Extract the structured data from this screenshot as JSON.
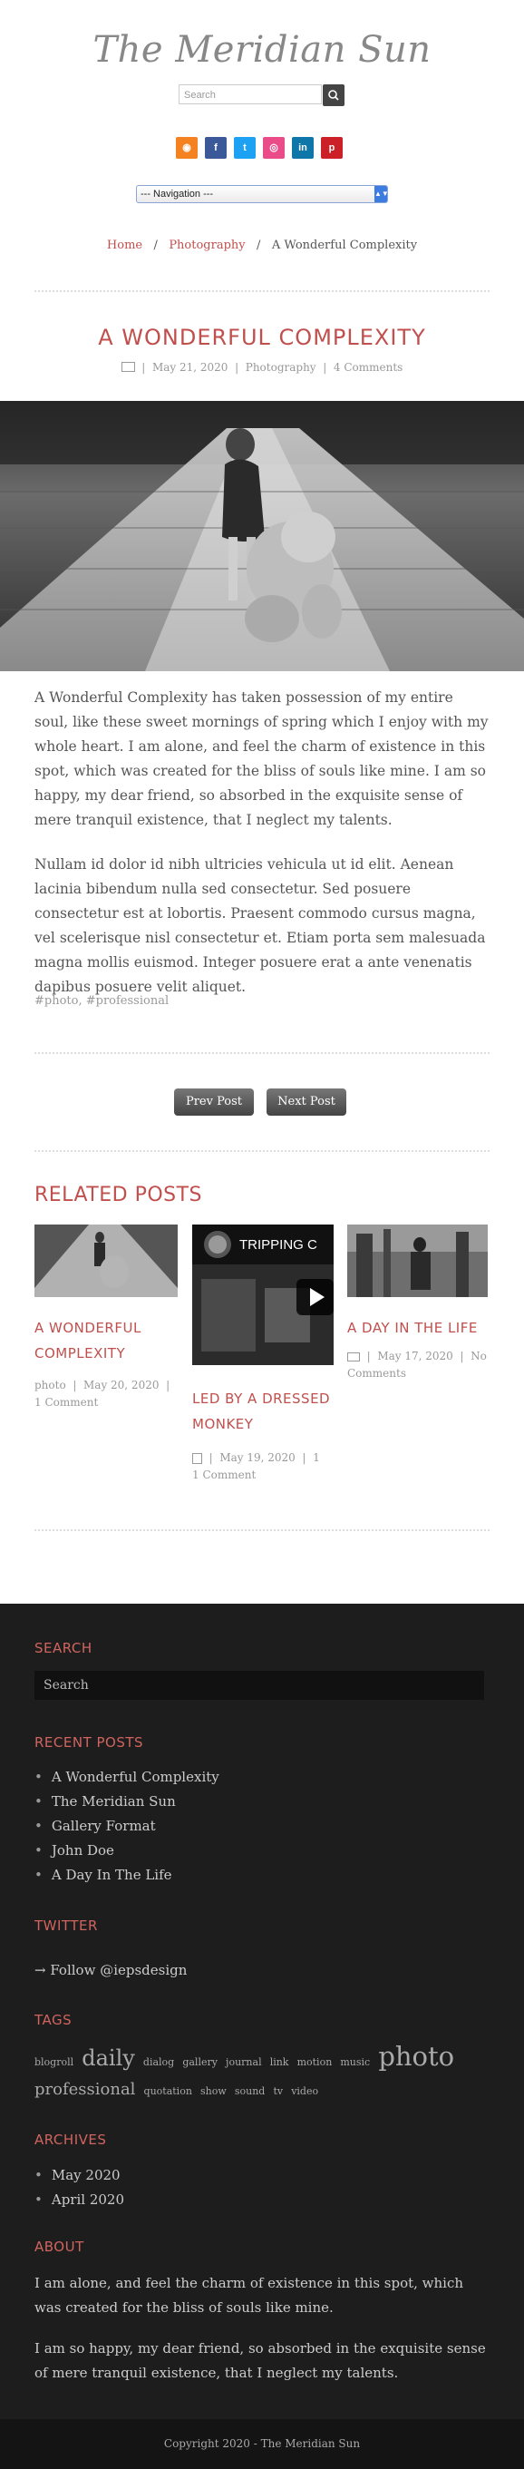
{
  "site": {
    "title": "The Meridian Sun",
    "search_placeholder": "Search"
  },
  "social": [
    {
      "name": "rss",
      "color": "#f58220",
      "glyph": "◉"
    },
    {
      "name": "facebook",
      "color": "#3b5998",
      "glyph": "f"
    },
    {
      "name": "twitter",
      "color": "#1da1f2",
      "glyph": "t"
    },
    {
      "name": "dribbble",
      "color": "#ea4c89",
      "glyph": "◎"
    },
    {
      "name": "linkedin",
      "color": "#0e76a8",
      "glyph": "in"
    },
    {
      "name": "pinterest",
      "color": "#cb2027",
      "glyph": "p"
    }
  ],
  "nav": {
    "selected": "--- Navigation ---"
  },
  "breadcrumb": {
    "home": "Home",
    "category": "Photography",
    "current": "A Wonderful Complexity",
    "sep": "/"
  },
  "post": {
    "title": "A WONDERFUL COMPLEXITY",
    "date": "May 21, 2020",
    "category": "Photography",
    "comments": "4 Comments",
    "p1": "A Wonderful Complexity has taken possession of my entire soul, like these sweet mornings of spring which I enjoy with my whole heart. I am alone, and feel the charm of existence in this spot, which was created for the bliss of souls like mine. I am so happy, my dear friend, so absorbed in the exquisite sense of mere tranquil existence, that I neglect my talents.",
    "p2": "Nullam id dolor id nibh ultricies vehicula ut id elit. Aenean lacinia bibendum nulla sed consectetur. Sed posuere consectetur est at lobortis. Praesent commodo cursus magna, vel scelerisque nisl consectetur et. Etiam porta sem malesuada magna mollis euismod. Integer posuere erat a ante venenatis dapibus posuere velit aliquet.",
    "tags": "#photo, #professional"
  },
  "pager": {
    "prev": "Prev Post",
    "next": "Next Post"
  },
  "related": {
    "heading": "RELATED POSTS",
    "items": [
      {
        "title": "A WONDERFUL COMPLEXITY",
        "category": "photo",
        "date": "May 20, 2020",
        "comments": "1 Comment"
      },
      {
        "title": "LED BY A DRESSED MONKEY",
        "video_title": "TRIPPING C",
        "date": "May 19, 2020",
        "comments": "1 Comment"
      },
      {
        "title": "A DAY IN THE LIFE",
        "date": "May 17, 2020",
        "comments": "No Comments"
      }
    ]
  },
  "footer": {
    "search": {
      "heading": "SEARCH",
      "placeholder": "Search"
    },
    "recent": {
      "heading": "RECENT POSTS",
      "items": [
        "A Wonderful Complexity",
        "The Meridian Sun",
        "Gallery Format",
        "John Doe",
        "A Day In The Life"
      ]
    },
    "twitter": {
      "heading": "TWITTER",
      "follow": "→ Follow @iepsdesign"
    },
    "tags": {
      "heading": "TAGS",
      "items": [
        "blogroll",
        "daily",
        "dialog",
        "gallery",
        "journal",
        "link",
        "motion",
        "music",
        "photo",
        "professional",
        "quotation",
        "show",
        "sound",
        "tv",
        "video"
      ]
    },
    "archives": {
      "heading": "ARCHIVES",
      "items": [
        "May 2020",
        "April 2020"
      ]
    },
    "about": {
      "heading": "ABOUT",
      "p1": "I am alone, and feel the charm of existence in this spot, which was created for the bliss of souls like mine.",
      "p2": "I am so happy, my dear friend, so absorbed in the exquisite sense of mere tranquil existence, that I neglect my talents."
    },
    "copyright": "Copyright 2020 - The Meridian Sun"
  },
  "colors": {
    "accent": "#c0504d",
    "footer_bg": "#1d1d1d"
  }
}
